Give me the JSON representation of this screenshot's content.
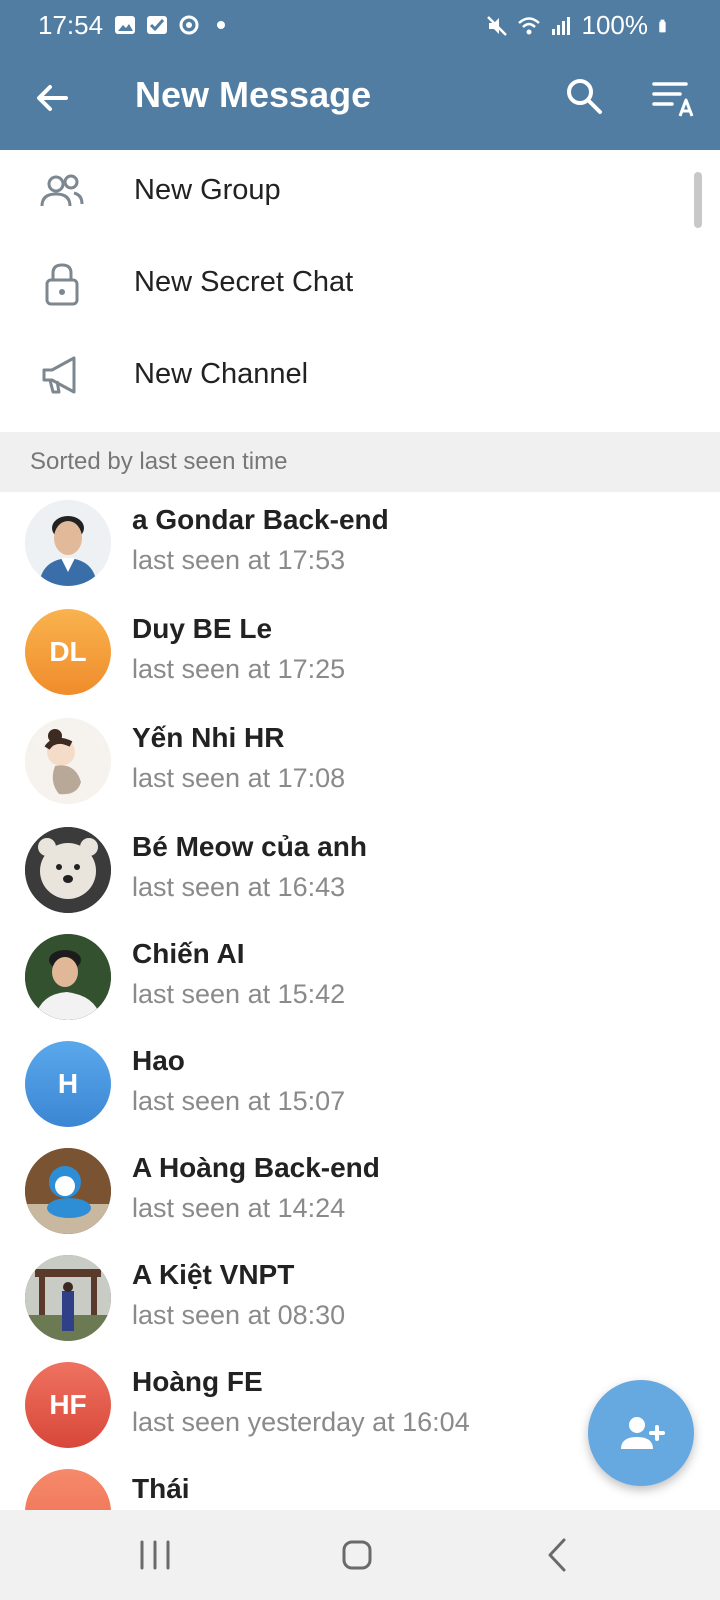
{
  "status_bar": {
    "time": "17:54",
    "battery": "100%"
  },
  "header": {
    "title": "New Message"
  },
  "menu": [
    {
      "label": "New Group",
      "icon": "group-icon"
    },
    {
      "label": "New Secret Chat",
      "icon": "lock-icon"
    },
    {
      "label": "New Channel",
      "icon": "megaphone-icon"
    }
  ],
  "section_header": "Sorted by last seen time",
  "contacts": [
    {
      "name": "a Gondar Back-end",
      "status": "last seen at 17:53",
      "initials": "",
      "color": "#dfe6ee"
    },
    {
      "name": "Duy BE Le",
      "status": "last seen at 17:25",
      "initials": "DL",
      "color": "#f5a141"
    },
    {
      "name": "Yến Nhi HR",
      "status": "last seen at 17:08",
      "initials": "",
      "color": "#f1eeea"
    },
    {
      "name": "Bé Meow của anh",
      "status": "last seen at 16:43",
      "initials": "",
      "color": "#3b3b3b"
    },
    {
      "name": "Chiến AI",
      "status": "last seen at 15:42",
      "initials": "",
      "color": "#3e5a3a"
    },
    {
      "name": "Hao",
      "status": "last seen at 15:07",
      "initials": "H",
      "color": "#4a9ae0"
    },
    {
      "name": "A Hoàng Back-end",
      "status": "last seen at 14:24",
      "initials": "",
      "color": "#6b4a2e"
    },
    {
      "name": "A Kiệt VNPT",
      "status": "last seen at 08:30",
      "initials": "",
      "color": "#5a6a4a"
    },
    {
      "name": "Hoàng FE",
      "status": "last seen yesterday at 16:04",
      "initials": "HF",
      "color": "#e5604e"
    },
    {
      "name": "Thái",
      "status": "",
      "initials": "",
      "color": "#f27a57"
    }
  ],
  "colors": {
    "header": "#517da2",
    "fab": "#65a9e0",
    "accent_text": "#8a8a8a"
  }
}
